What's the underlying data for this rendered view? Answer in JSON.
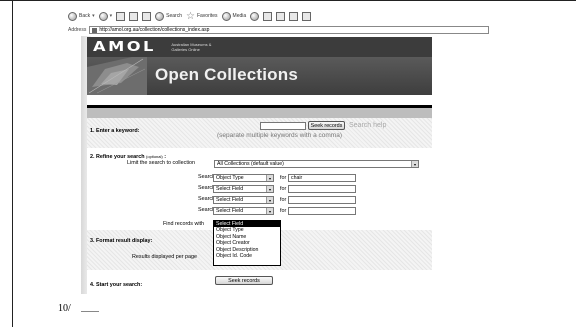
{
  "browser": {
    "toolbar": {
      "back_label": "Back",
      "search_label": "Search",
      "favorites_label": "Favorites",
      "media_label": "Media",
      "icons": [
        "back-icon",
        "forward-icon",
        "stop-icon",
        "refresh-icon",
        "home-icon",
        "search-icon",
        "favorites-icon",
        "media-icon",
        "history-icon",
        "mail-icon",
        "print-icon",
        "edit-icon",
        "messenger-icon"
      ]
    },
    "address": {
      "label": "Address",
      "url": "http://amol.org.au/collection/collections_index.asp"
    }
  },
  "site": {
    "logo": "AMOL",
    "logo_subtitle": "Australian Museums & Galleries Online",
    "banner_title": "Open Collections"
  },
  "form": {
    "keyword": {
      "label": "1. Enter a keyword:",
      "value": "",
      "seek_button": "Seek records",
      "help_link": "Search help",
      "note": "(separate multiple keywords with a comma)"
    },
    "refine": {
      "label_bold": "2. Refine your search",
      "label_optional": "(optional)",
      "label_colon": ":",
      "limit_label": "Limit the search to collection",
      "collection_selected": "All Collections (default value)",
      "search_in_label": "Search in",
      "for_label": "for",
      "rows": [
        {
          "field": "Object Type",
          "value": "chair"
        },
        {
          "field": "Select Field",
          "value": ""
        },
        {
          "field": "Select Field",
          "value": ""
        },
        {
          "field": "Select Field",
          "value": ""
        }
      ],
      "find_records_label": "Find records with"
    },
    "dropdown_options": [
      "Select Field",
      "Object Type",
      "Object Name",
      "Object Creator",
      "Object Description",
      "Object Id. Code"
    ],
    "format": {
      "label": "3. Format result display:",
      "per_page_label": "Results displayed per page"
    },
    "start": {
      "label": "4. Start your search:",
      "seek_button": "Seek records"
    }
  },
  "slide": {
    "page_mark": "10/"
  }
}
